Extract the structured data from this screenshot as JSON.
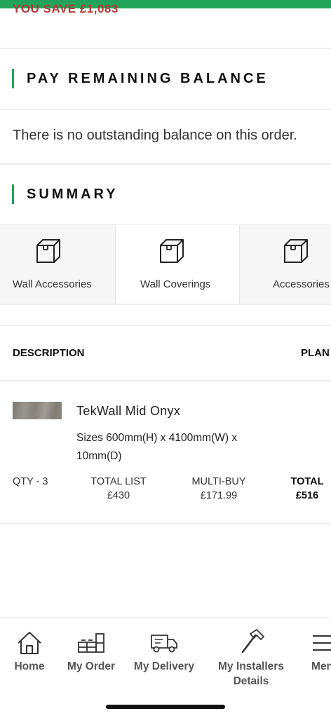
{
  "header": {
    "you_save": "YOU SAVE £1,083"
  },
  "pay_section": {
    "title": "PAY REMAINING BALANCE",
    "message": "There is no outstanding balance on this order."
  },
  "summary": {
    "title": "SUMMARY",
    "categories": [
      {
        "label": "Wall Accessories",
        "icon": "box-icon"
      },
      {
        "label": "Wall Coverings",
        "icon": "box-icon"
      },
      {
        "label": "Accessories",
        "icon": "box-icon"
      }
    ]
  },
  "table": {
    "col_description": "DESCRIPTION",
    "col_plan": "PLAN",
    "item": {
      "name": "TekWall Mid Onyx",
      "sizes": "Sizes 600mm(H) x 4100mm(W) x 10mm(D)",
      "qty": "QTY - 3",
      "total_list_label": "TOTAL LIST",
      "total_list_value": "£430",
      "multibuy_label": "MULTI-BUY",
      "multibuy_value": "£171.99",
      "total_label": "TOTAL",
      "total_value": "£516"
    }
  },
  "nav": {
    "items": [
      {
        "label": "Home",
        "icon": "home-icon"
      },
      {
        "label": "My Order",
        "icon": "kitchen-icon"
      },
      {
        "label": "My Delivery",
        "icon": "truck-icon"
      },
      {
        "label": "My Installers Details",
        "icon": "hammer-icon"
      },
      {
        "label": "Menu",
        "icon": "menu-icon"
      }
    ]
  },
  "colors": {
    "accent": "#21a45a",
    "savings": "#b23a3a"
  }
}
